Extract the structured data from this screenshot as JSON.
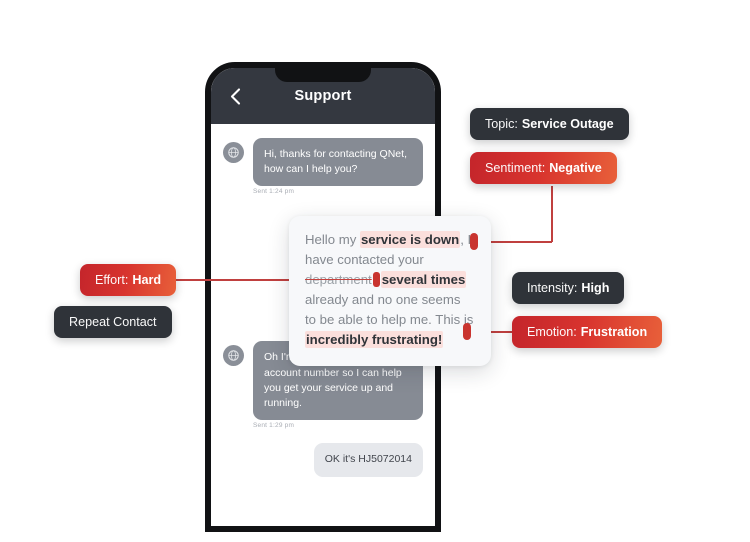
{
  "phone": {
    "header": {
      "back_icon": "chevron-left-icon",
      "title": "Support"
    },
    "messages": [
      {
        "role": "agent",
        "text": "Hi, thanks for contacting QNet, how can I help you?",
        "time": "Sent 1:24 pm"
      },
      {
        "role": "agent",
        "text": "Oh I'm sorry! Let me get your account number so I can help you get your service up and running.",
        "time": "Sent 1:29 pm"
      },
      {
        "role": "customer",
        "text": "OK it's HJ5072014",
        "time": ""
      }
    ]
  },
  "focus_message": {
    "segments": [
      {
        "text": "Hello my ",
        "style": "plain"
      },
      {
        "text": "service is down",
        "style": "highlight"
      },
      {
        "text": ", I have contacted your ",
        "style": "plain"
      },
      {
        "text": "department",
        "style": "strikethrough"
      },
      {
        "text": "marker",
        "style": "marker"
      },
      {
        "text": "several times",
        "style": "highlight"
      },
      {
        "text": " already and no one seems to be able to help me. This is ",
        "style": "plain"
      },
      {
        "text": "incredibly frustrating!",
        "style": "highlight"
      }
    ]
  },
  "annotations": [
    {
      "id": "topic",
      "label": "Topic:",
      "value": "Service Outage",
      "color": "#2f3339",
      "variant": "dark"
    },
    {
      "id": "sentiment",
      "label": "Sentiment:",
      "value": "Negative",
      "color": "#d8342e",
      "variant": "red"
    },
    {
      "id": "intensity",
      "label": "Intensity:",
      "value": "High",
      "color": "#2f3339",
      "variant": "dark"
    },
    {
      "id": "emotion",
      "label": "Emotion:",
      "value": "Frustration",
      "color": "#d8342e",
      "variant": "red"
    },
    {
      "id": "effort",
      "label": "Effort:",
      "value": "Hard",
      "color": "#d8342e",
      "variant": "red"
    },
    {
      "id": "repeat",
      "label": "Repeat Contact",
      "value": "",
      "color": "#2f3339",
      "variant": "dark"
    }
  ]
}
